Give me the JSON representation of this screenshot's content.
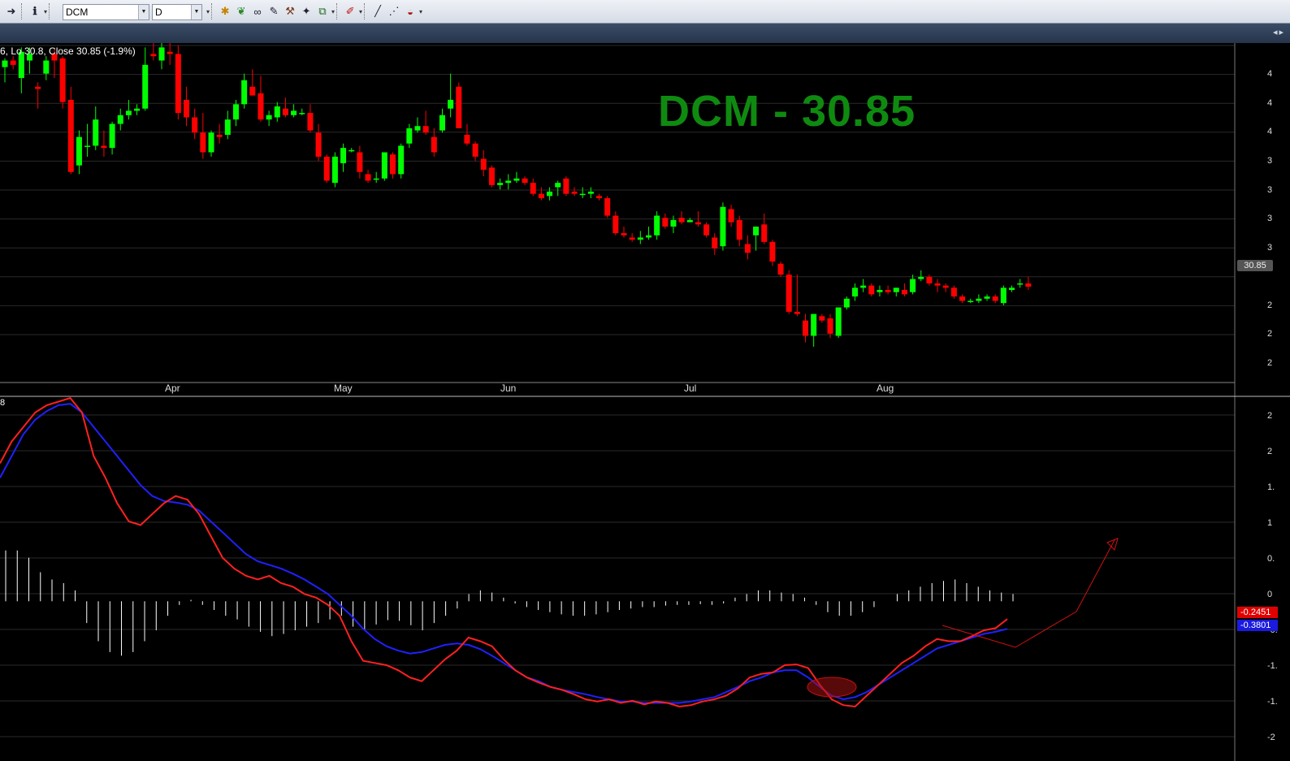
{
  "toolbar": {
    "symbol": "DCM",
    "interval": "D"
  },
  "colors": {
    "up": "#00ff00",
    "down": "#ff0000",
    "title": "#0f8a10",
    "macd": "#ff2020",
    "signal": "#2020ff",
    "histogram": "#ffffff",
    "grid": "#2a2a2a"
  },
  "price_info": "6, Lo 30.8, Close 30.85 (-1.9%)",
  "title": "DCM - 30.85",
  "last_price_tag": "30.85",
  "macd_tag": "-0.2451",
  "signal_tag": "-0.3801",
  "macd_top_label": "8",
  "months": [
    "Apr",
    "May",
    "Jun",
    "Jul",
    "Aug"
  ],
  "price_axis_labels": [
    "4",
    "4",
    "4",
    "3",
    "3",
    "3",
    "3",
    "2",
    "2",
    "2"
  ],
  "macd_axis_labels": [
    "2",
    "2",
    "1.",
    "1",
    "0.",
    "0",
    "-0.",
    "-1.",
    "-1.",
    "-2"
  ],
  "chart_data": {
    "type": "candlestick",
    "symbol": "DCM",
    "candles": [
      [
        40.9,
        41.3,
        40.2,
        41.2
      ],
      [
        41.2,
        41.4,
        40.8,
        41.0
      ],
      [
        40.4,
        41.8,
        39.7,
        41.6
      ],
      [
        41.2,
        41.8,
        40.6,
        41.5
      ],
      [
        40.0,
        40.2,
        39.0,
        39.9
      ],
      [
        40.6,
        41.4,
        40.3,
        41.2
      ],
      [
        41.5,
        41.7,
        40.4,
        41.2
      ],
      [
        41.3,
        41.4,
        39.0,
        39.3
      ],
      [
        39.4,
        40.0,
        36.0,
        36.1
      ],
      [
        36.4,
        38.0,
        36.0,
        37.7
      ],
      [
        37.3,
        38.3,
        36.8,
        37.3
      ],
      [
        37.3,
        39.1,
        37.1,
        38.5
      ],
      [
        37.3,
        38.0,
        36.8,
        37.2
      ],
      [
        37.2,
        38.4,
        36.9,
        38.3
      ],
      [
        38.3,
        39.0,
        38.0,
        38.7
      ],
      [
        38.7,
        39.4,
        38.5,
        38.9
      ],
      [
        38.9,
        39.2,
        38.7,
        39.0
      ],
      [
        39.0,
        41.8,
        38.9,
        41.0
      ],
      [
        41.5,
        42.0,
        41.2,
        41.4
      ],
      [
        41.2,
        42.1,
        40.8,
        41.8
      ],
      [
        41.6,
        42.0,
        41.0,
        41.5
      ],
      [
        41.5,
        41.9,
        38.5,
        38.8
      ],
      [
        39.4,
        40.0,
        38.2,
        38.6
      ],
      [
        38.6,
        39.0,
        37.6,
        37.9
      ],
      [
        37.9,
        38.8,
        36.7,
        37.0
      ],
      [
        37.0,
        38.0,
        36.8,
        37.9
      ],
      [
        37.8,
        38.3,
        37.4,
        37.7
      ],
      [
        37.8,
        38.9,
        37.6,
        38.5
      ],
      [
        38.5,
        39.4,
        38.2,
        39.2
      ],
      [
        39.2,
        40.6,
        39.0,
        40.3
      ],
      [
        40.0,
        40.8,
        39.6,
        39.6
      ],
      [
        39.7,
        40.5,
        38.4,
        38.5
      ],
      [
        38.5,
        38.9,
        38.2,
        38.7
      ],
      [
        38.6,
        39.3,
        38.4,
        39.1
      ],
      [
        39.0,
        39.5,
        38.6,
        38.7
      ],
      [
        38.7,
        39.2,
        38.6,
        38.9
      ],
      [
        38.8,
        39.0,
        38.7,
        38.8
      ],
      [
        38.8,
        39.2,
        37.9,
        38.0
      ],
      [
        37.9,
        38.3,
        36.6,
        36.8
      ],
      [
        36.8,
        36.9,
        35.6,
        35.7
      ],
      [
        35.6,
        37.0,
        35.4,
        36.8
      ],
      [
        36.5,
        37.4,
        36.1,
        37.2
      ],
      [
        37.1,
        37.2,
        37.0,
        37.1
      ],
      [
        37.0,
        37.3,
        35.8,
        36.1
      ],
      [
        36.0,
        36.2,
        35.6,
        35.7
      ],
      [
        35.8,
        36.1,
        35.6,
        35.8
      ],
      [
        35.8,
        37.0,
        35.7,
        37.0
      ],
      [
        36.9,
        37.0,
        35.8,
        36.0
      ],
      [
        36.0,
        37.4,
        35.8,
        37.3
      ],
      [
        37.4,
        38.3,
        37.2,
        38.1
      ],
      [
        38.0,
        38.6,
        37.9,
        38.2
      ],
      [
        38.2,
        38.9,
        37.8,
        37.9
      ],
      [
        37.7,
        38.1,
        36.8,
        37.0
      ],
      [
        38.0,
        39.0,
        37.9,
        38.7
      ],
      [
        39.0,
        40.6,
        38.6,
        39.4
      ],
      [
        40.0,
        40.2,
        38.1,
        38.1
      ],
      [
        37.8,
        38.3,
        37.3,
        37.4
      ],
      [
        37.4,
        37.5,
        36.6,
        36.8
      ],
      [
        36.7,
        37.1,
        35.9,
        36.2
      ],
      [
        36.3,
        36.4,
        35.4,
        35.5
      ],
      [
        35.5,
        35.8,
        35.3,
        35.6
      ],
      [
        35.6,
        36.0,
        35.3,
        35.7
      ],
      [
        35.7,
        36.1,
        35.6,
        35.8
      ],
      [
        35.8,
        35.9,
        35.5,
        35.6
      ],
      [
        35.6,
        35.8,
        35.0,
        35.1
      ],
      [
        35.1,
        35.4,
        34.8,
        34.9
      ],
      [
        35.0,
        35.4,
        34.8,
        35.2
      ],
      [
        35.4,
        35.7,
        35.0,
        35.6
      ],
      [
        35.8,
        35.9,
        35.0,
        35.1
      ],
      [
        35.2,
        35.4,
        35.0,
        35.1
      ],
      [
        35.1,
        35.4,
        34.9,
        35.1
      ],
      [
        35.1,
        35.4,
        34.9,
        35.2
      ],
      [
        35.0,
        35.1,
        34.8,
        34.9
      ],
      [
        34.9,
        35.0,
        34.0,
        34.1
      ],
      [
        34.1,
        34.3,
        33.2,
        33.3
      ],
      [
        33.3,
        33.6,
        33.1,
        33.2
      ],
      [
        33.1,
        33.3,
        32.9,
        33.0
      ],
      [
        33.0,
        33.4,
        32.8,
        33.1
      ],
      [
        33.1,
        33.6,
        33.0,
        33.2
      ],
      [
        33.2,
        34.3,
        33.0,
        34.1
      ],
      [
        34.0,
        34.2,
        33.5,
        33.6
      ],
      [
        33.6,
        34.1,
        33.3,
        33.9
      ],
      [
        34.0,
        34.3,
        33.7,
        33.8
      ],
      [
        33.8,
        34.0,
        33.8,
        33.9
      ],
      [
        33.8,
        34.3,
        33.6,
        33.7
      ],
      [
        33.7,
        33.8,
        33.1,
        33.2
      ],
      [
        33.1,
        33.3,
        32.3,
        32.6
      ],
      [
        32.7,
        34.7,
        32.5,
        34.5
      ],
      [
        34.4,
        34.6,
        33.6,
        33.8
      ],
      [
        33.9,
        34.1,
        32.7,
        33.0
      ],
      [
        32.8,
        33.2,
        32.1,
        32.4
      ],
      [
        33.2,
        33.6,
        32.5,
        33.6
      ],
      [
        33.7,
        34.2,
        32.8,
        32.9
      ],
      [
        32.9,
        33.0,
        31.8,
        32.0
      ],
      [
        31.9,
        32.0,
        31.3,
        31.4
      ],
      [
        31.4,
        31.6,
        29.6,
        29.7
      ],
      [
        29.7,
        31.4,
        29.5,
        29.6
      ],
      [
        29.3,
        29.6,
        28.3,
        28.6
      ],
      [
        28.6,
        29.5,
        28.1,
        29.6
      ],
      [
        29.5,
        29.6,
        29.2,
        29.3
      ],
      [
        29.4,
        29.6,
        28.5,
        28.7
      ],
      [
        28.6,
        29.9,
        28.5,
        29.9
      ],
      [
        29.9,
        30.4,
        29.8,
        30.3
      ],
      [
        30.4,
        31.0,
        30.2,
        30.8
      ],
      [
        30.8,
        31.2,
        30.6,
        30.9
      ],
      [
        30.9,
        31.0,
        30.4,
        30.5
      ],
      [
        30.6,
        30.9,
        30.4,
        30.7
      ],
      [
        30.7,
        30.9,
        30.5,
        30.6
      ],
      [
        30.6,
        30.8,
        30.4,
        30.8
      ],
      [
        30.7,
        31.0,
        30.4,
        30.5
      ],
      [
        30.6,
        31.4,
        30.5,
        31.2
      ],
      [
        31.2,
        31.6,
        31.1,
        31.3
      ],
      [
        31.3,
        31.4,
        30.9,
        31.0
      ],
      [
        31.0,
        31.2,
        30.6,
        30.9
      ],
      [
        30.9,
        31.0,
        30.6,
        30.8
      ],
      [
        30.8,
        30.9,
        30.3,
        30.4
      ],
      [
        30.4,
        30.5,
        30.1,
        30.2
      ],
      [
        30.2,
        30.3,
        30.1,
        30.2
      ],
      [
        30.2,
        30.5,
        30.1,
        30.3
      ],
      [
        30.3,
        30.5,
        30.2,
        30.4
      ],
      [
        30.4,
        30.5,
        30.1,
        30.2
      ],
      [
        30.1,
        30.9,
        30.0,
        30.8
      ],
      [
        30.7,
        30.9,
        30.6,
        30.8
      ],
      [
        31.0,
        31.2,
        30.8,
        31.0
      ],
      [
        31.0,
        31.3,
        30.7,
        30.85
      ]
    ],
    "macd": [
      1.9,
      2.2,
      2.4,
      2.6,
      2.7,
      2.75,
      2.8,
      2.6,
      2.0,
      1.7,
      1.35,
      1.1,
      1.05,
      1.2,
      1.35,
      1.45,
      1.4,
      1.2,
      0.9,
      0.6,
      0.45,
      0.35,
      0.3,
      0.35,
      0.25,
      0.2,
      0.1,
      0.05,
      -0.05,
      -0.2,
      -0.55,
      -0.82,
      -0.85,
      -0.88,
      -0.95,
      -1.05,
      -1.1,
      -0.95,
      -0.8,
      -0.68,
      -0.5,
      -0.55,
      -0.62,
      -0.8,
      -0.95,
      -1.05,
      -1.12,
      -1.18,
      -1.22,
      -1.28,
      -1.35,
      -1.38,
      -1.35,
      -1.4,
      -1.37,
      -1.42,
      -1.38,
      -1.4,
      -1.45,
      -1.43,
      -1.38,
      -1.35,
      -1.3,
      -1.2,
      -1.05,
      -1.0,
      -0.98,
      -0.88,
      -0.87,
      -0.92,
      -1.15,
      -1.35,
      -1.43,
      -1.45,
      -1.3,
      -1.15,
      -1.0,
      -0.85,
      -0.75,
      -0.62,
      -0.52,
      -0.55,
      -0.55,
      -0.48,
      -0.4,
      -0.37,
      -0.2451
    ],
    "signal": [
      1.7,
      2.0,
      2.3,
      2.5,
      2.62,
      2.7,
      2.72,
      2.6,
      2.4,
      2.2,
      2.0,
      1.8,
      1.6,
      1.45,
      1.38,
      1.36,
      1.33,
      1.25,
      1.1,
      0.95,
      0.8,
      0.65,
      0.55,
      0.5,
      0.45,
      0.38,
      0.3,
      0.2,
      0.1,
      -0.05,
      -0.2,
      -0.38,
      -0.52,
      -0.62,
      -0.68,
      -0.72,
      -0.7,
      -0.65,
      -0.6,
      -0.58,
      -0.6,
      -0.66,
      -0.75,
      -0.85,
      -0.95,
      -1.05,
      -1.1,
      -1.18,
      -1.22,
      -1.25,
      -1.28,
      -1.32,
      -1.35,
      -1.38,
      -1.38,
      -1.4,
      -1.4,
      -1.4,
      -1.4,
      -1.38,
      -1.35,
      -1.32,
      -1.25,
      -1.18,
      -1.1,
      -1.05,
      -0.98,
      -0.95,
      -0.95,
      -1.05,
      -1.18,
      -1.3,
      -1.35,
      -1.32,
      -1.25,
      -1.15,
      -1.05,
      -0.95,
      -0.85,
      -0.75,
      -0.65,
      -0.6,
      -0.55,
      -0.5,
      -0.45,
      -0.42,
      -0.3801
    ],
    "histogram": [
      0.7,
      0.7,
      0.6,
      0.4,
      0.3,
      0.25,
      0.15,
      -0.3,
      -0.55,
      -0.7,
      -0.75,
      -0.7,
      -0.55,
      -0.4,
      -0.2,
      -0.05,
      0.02,
      -0.05,
      -0.12,
      -0.2,
      -0.25,
      -0.35,
      -0.42,
      -0.48,
      -0.45,
      -0.4,
      -0.35,
      -0.3,
      -0.25,
      -0.2,
      -0.35,
      -0.4,
      -0.32,
      -0.26,
      -0.27,
      -0.33,
      -0.4,
      -0.3,
      -0.2,
      -0.1,
      0.1,
      0.15,
      0.12,
      0.05,
      -0.03,
      -0.08,
      -0.12,
      -0.15,
      -0.18,
      -0.2,
      -0.2,
      -0.18,
      -0.15,
      -0.12,
      -0.1,
      -0.08,
      -0.08,
      -0.06,
      -0.05,
      -0.05,
      -0.04,
      -0.05,
      -0.03,
      0.05,
      0.1,
      0.15,
      0.15,
      0.12,
      0.1,
      0.05,
      -0.05,
      -0.15,
      -0.2,
      -0.2,
      -0.15,
      -0.08,
      0.0,
      0.1,
      0.15,
      0.2,
      0.25,
      0.28,
      0.3,
      0.25,
      0.2,
      0.15,
      0.12,
      0.1
    ],
    "annotations": [
      "ellipse at MACD crossover near late July",
      "projected arrow toward upside"
    ]
  }
}
